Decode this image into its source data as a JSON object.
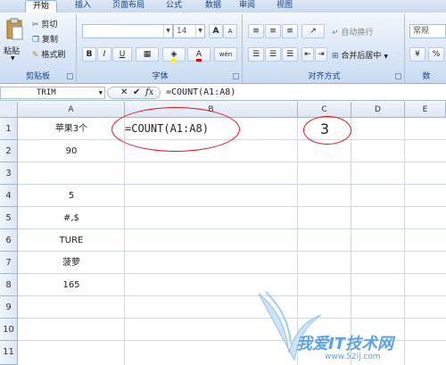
{
  "tabs": [
    "开始",
    "插入",
    "页面布局",
    "公式",
    "数据",
    "审阅",
    "视图"
  ],
  "clipboard": {
    "paste": "粘贴",
    "cut": "剪切",
    "copy": "复制",
    "format_painter": "格式刷",
    "label": "剪贴板"
  },
  "font": {
    "size": "14",
    "bold": "B",
    "italic": "I",
    "underline": "U",
    "grow": "A",
    "shrink": "A",
    "label": "字体",
    "phonetic": "wén"
  },
  "alignment": {
    "wrap": "自动换行",
    "merge": "合并后居中",
    "label": "对齐方式"
  },
  "number": {
    "format": "常规",
    "label": "数",
    "percent": "%"
  },
  "formula_bar": {
    "name_box": "TRIM",
    "fx": "fx",
    "formula": "=COUNT(A1:A8)"
  },
  "columns": [
    "A",
    "B",
    "C",
    "D",
    "E"
  ],
  "rows": [
    "1",
    "2",
    "3",
    "4",
    "5",
    "6",
    "7",
    "8",
    "9",
    "10",
    "11"
  ],
  "cells": {
    "A1": "苹果3个",
    "A2": "90",
    "A3": "",
    "A4": "5",
    "A5": "#,$",
    "A6": "TURE",
    "A7": "菠萝",
    "A8": "165",
    "B1": "=COUNT(A1:A8)",
    "C1": "3"
  },
  "watermark": {
    "brand": "我爱IT技术网",
    "url": "www.52ij.com"
  },
  "colors": {
    "annotation": "#e0141b",
    "watermark": "#5ba3e6",
    "ribbon": "#dbe7f6"
  }
}
